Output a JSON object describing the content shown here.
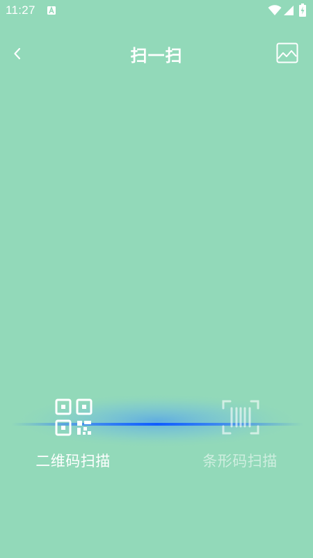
{
  "status_bar": {
    "time": "11:27",
    "icons": [
      "notification-a-icon",
      "wifi-icon",
      "signal-icon",
      "battery-charging-icon"
    ]
  },
  "header": {
    "title": "扫一扫",
    "back_icon": "chevron-left-icon",
    "album_icon": "image-icon"
  },
  "scan_modes": [
    {
      "label": "二维码扫描",
      "icon": "qr-code-icon",
      "active": true
    },
    {
      "label": "条形码扫描",
      "icon": "barcode-icon",
      "active": false
    }
  ],
  "colors": {
    "background": "#92d9b9",
    "scan_line": "#1e6bff",
    "text": "#ffffff"
  }
}
